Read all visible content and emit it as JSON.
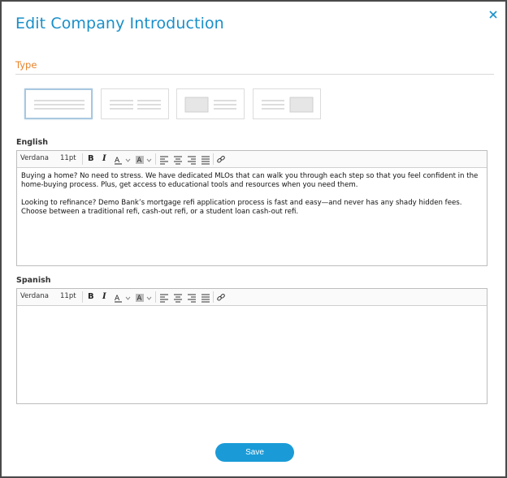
{
  "dialog": {
    "title": "Edit Company Introduction",
    "close_icon": "close-icon"
  },
  "type": {
    "label": "Type",
    "options": [
      {
        "name": "text-full-width",
        "selected": true
      },
      {
        "name": "text-two-columns",
        "selected": false
      },
      {
        "name": "image-left-text-right",
        "selected": false
      },
      {
        "name": "text-left-image-right",
        "selected": false
      }
    ]
  },
  "english": {
    "label": "English",
    "font": "Verdana",
    "size": "11pt",
    "paragraphs": [
      "Buying a home? No need to stress. We have dedicated MLOs that can walk you through each step so that you feel confident in the home-buying process. Plus, get access to educational tools and resources when you need them.",
      "Looking to refinance? Demo Bank’s mortgage refi application process is fast and easy—and never has any shady hidden fees. Choose between a traditional refi, cash-out refi, or a student loan cash-out refi."
    ]
  },
  "spanish": {
    "label": "Spanish",
    "font": "Verdana",
    "size": "11pt",
    "paragraphs": []
  },
  "toolbar": {
    "bold": "B",
    "italic": "I",
    "font_color": "A",
    "highlight": "A"
  },
  "footer": {
    "save_label": "Save"
  },
  "colors": {
    "accent": "#1a8fc9",
    "type_label": "#e8832a",
    "save_button": "#1a9bd7"
  }
}
